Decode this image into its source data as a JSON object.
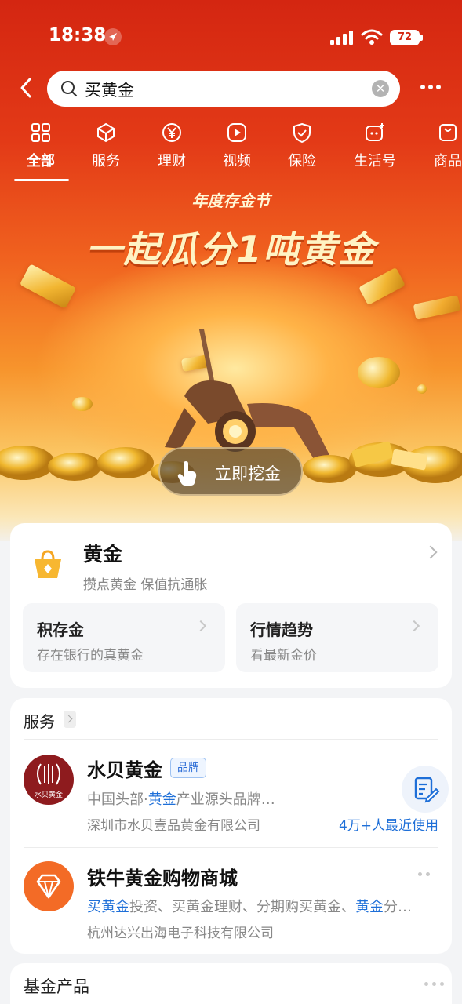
{
  "status_bar": {
    "time": "18:38",
    "battery": "72"
  },
  "search": {
    "query": "买黄金"
  },
  "tabs": [
    {
      "label": "全部"
    },
    {
      "label": "服务"
    },
    {
      "label": "理财"
    },
    {
      "label": "视频"
    },
    {
      "label": "保险"
    },
    {
      "label": "生活号"
    },
    {
      "label": "商品"
    }
  ],
  "banner": {
    "subtitle": "年度存金节",
    "title": "一起瓜分1吨黄金",
    "button": "立即挖金"
  },
  "gold_card": {
    "title": "黄金",
    "subtitle": "攒点黄金 保值抗通胀",
    "items": [
      {
        "title": "积存金",
        "desc": "存在银行的真黄金"
      },
      {
        "title": "行情趋势",
        "desc": "看最新金价"
      }
    ]
  },
  "services": {
    "title": "服务",
    "items": [
      {
        "logo_text": "水贝黄金",
        "name": "水贝黄金",
        "badge": "品牌",
        "desc_a": "中国头部·",
        "desc_b": "黄金",
        "desc_c": "产业源头品牌…",
        "company": "深圳市水贝壹品黄金有限公司",
        "usage": "4万+人最近使用"
      },
      {
        "name": "铁牛黄金购物商城",
        "desc_a": "买黄金",
        "desc_b": "投资、买黄金理财、分期购买黄金、",
        "desc_c": "黄金",
        "desc_d": "分…",
        "company": "杭州达兴出海电子科技有限公司"
      }
    ]
  },
  "fund": {
    "title": "基金产品"
  },
  "colors": {
    "brand_red": "#d42611",
    "link_blue": "#1e6fd8",
    "gold": "#f2b632"
  }
}
